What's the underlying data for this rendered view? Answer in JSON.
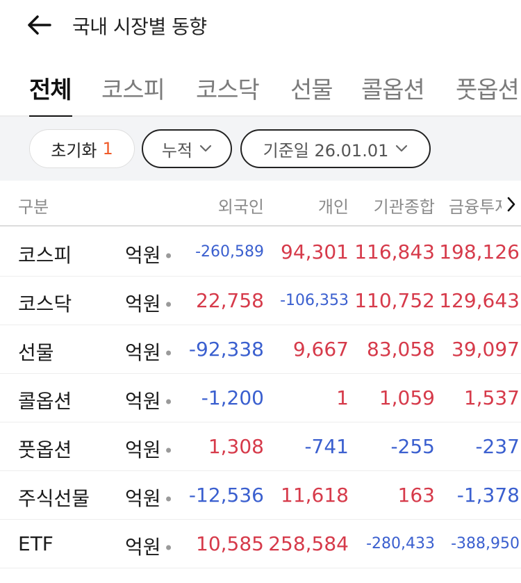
{
  "header": {
    "title": "국내 시장별 동향"
  },
  "tabs": [
    {
      "label": "전체",
      "active": true
    },
    {
      "label": "코스피",
      "active": false
    },
    {
      "label": "코스닥",
      "active": false
    },
    {
      "label": "선물",
      "active": false
    },
    {
      "label": "콜옵션",
      "active": false
    },
    {
      "label": "풋옵션",
      "active": false
    }
  ],
  "filters": {
    "reset_label": "초기화",
    "reset_count": "1",
    "mode_label": "누적",
    "date_label": "기준일 26.01.01"
  },
  "table": {
    "columns": [
      "구분",
      "외국인",
      "개인",
      "기관종합",
      "금융투자"
    ],
    "rows": [
      {
        "label": "코스피",
        "unit": "억원",
        "values": [
          "-260,589",
          "94,301",
          "116,843",
          "198,126"
        ]
      },
      {
        "label": "코스닥",
        "unit": "억원",
        "values": [
          "22,758",
          "-106,353",
          "110,752",
          "129,643"
        ]
      },
      {
        "label": "선물",
        "unit": "억원",
        "values": [
          "-92,338",
          "9,667",
          "83,058",
          "39,097"
        ]
      },
      {
        "label": "콜옵션",
        "unit": "억원",
        "values": [
          "-1,200",
          "1",
          "1,059",
          "1,537"
        ]
      },
      {
        "label": "풋옵션",
        "unit": "억원",
        "values": [
          "1,308",
          "-741",
          "-255",
          "-237"
        ]
      },
      {
        "label": "주식선물",
        "unit": "억원",
        "values": [
          "-12,536",
          "11,618",
          "163",
          "-1,378"
        ]
      },
      {
        "label": "ETF",
        "unit": "억원",
        "values": [
          "10,585",
          "258,584",
          "-280,433",
          "-388,950"
        ]
      }
    ]
  },
  "colors": {
    "positive": "#d63a4a",
    "negative": "#3a5fcf",
    "accent": "#f05a28"
  },
  "icons": {
    "back": "arrow-left-icon",
    "chevron": "chevron-down-icon",
    "more": "chevron-right-icon"
  }
}
